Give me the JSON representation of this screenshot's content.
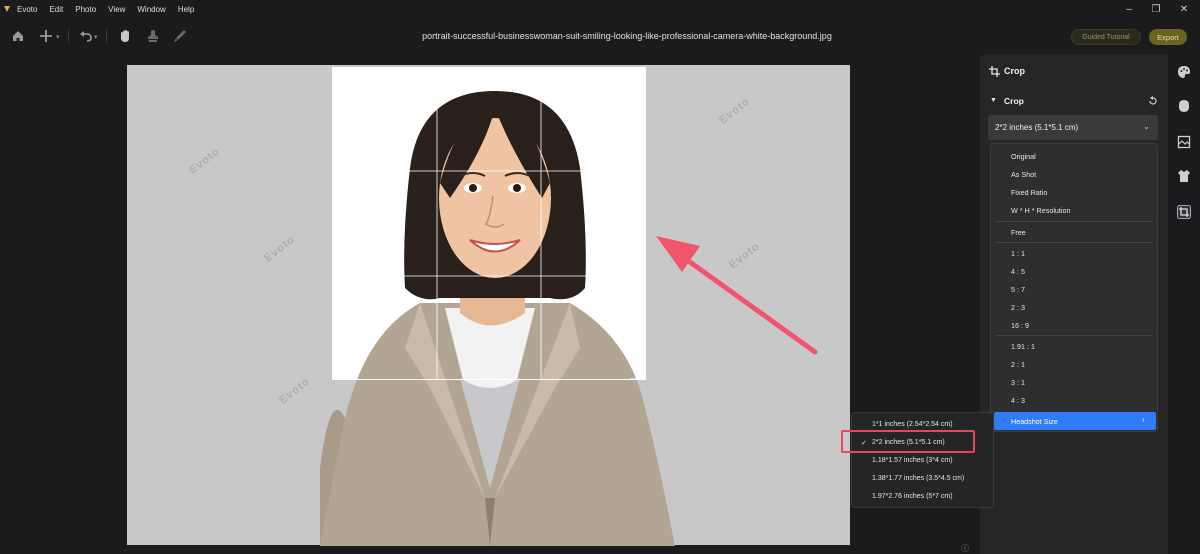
{
  "app": {
    "name": "Evoto",
    "menu": [
      "Evoto",
      "Edit",
      "Photo",
      "View",
      "Window",
      "Help"
    ]
  },
  "toolbar": {
    "filename": "portrait-successful-businesswoman-suit-smiling-looking-like-professional-camera-white-background.jpg",
    "guided_label": "Guided Tutorial",
    "export_label": "Export",
    "icons": [
      "home-icon",
      "add-icon",
      "undo-icon",
      "hand-icon",
      "stamp-icon",
      "brush-icon"
    ]
  },
  "canvas": {
    "watermark": "Evoto"
  },
  "panel": {
    "title": "Crop",
    "section_title": "Crop",
    "selected_value": "2*2 inches (5.1*5.1 cm)",
    "dropdown_groups": [
      [
        "Original",
        "As Shot",
        "Fixed Ratio",
        "W * H * Resolution"
      ],
      [
        "Free"
      ],
      [
        "1 : 1",
        "4 : 5",
        "5 : 7",
        "2 : 3",
        "16 : 9"
      ],
      [
        "1.91 : 1",
        "2 : 1",
        "3 : 1",
        "4 : 3"
      ],
      [
        "Headshot Size"
      ]
    ],
    "highlighted": "Headshot Size"
  },
  "submenu": {
    "items": [
      "1*1 inches (2.54*2.54 cm)",
      "2*2 inches (5.1*5.1 cm)",
      "1.18*1.57 inches (3*4 cm)",
      "1.38*1.77 inches (3.5*4.5 cm)",
      "1.97*2.76 inches (5*7 cm)"
    ],
    "checked": "2*2 inches (5.1*5.1 cm)"
  },
  "colors": {
    "accent": "#2f7cf6",
    "annotation": "#e5475b",
    "export": "#6a6423"
  }
}
